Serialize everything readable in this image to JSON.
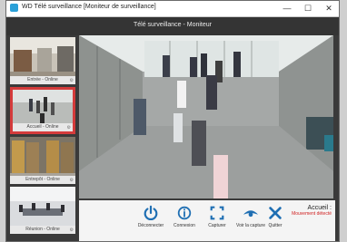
{
  "window": {
    "title": "WD Télé surveillance [Moniteur de surveillance]",
    "minimize": "—",
    "maximize": "☐",
    "close": "✕"
  },
  "header": {
    "title": "Télé surveillance - Moniteur"
  },
  "cameras": [
    {
      "label": "Entrée - Online",
      "active": false
    },
    {
      "label": "Accueil - Online",
      "active": true
    },
    {
      "label": "Entrepôt - Online",
      "active": false
    },
    {
      "label": "Réunion - Online",
      "active": false
    }
  ],
  "controls": [
    {
      "label": "Déconnecter",
      "icon": "power-icon"
    },
    {
      "label": "Connexion",
      "icon": "info-icon"
    },
    {
      "label": "Capturer",
      "icon": "capture-icon"
    },
    {
      "label": "Voir la capture",
      "icon": "eye-icon"
    },
    {
      "label": "Quitter",
      "icon": "close-icon"
    }
  ],
  "alert": {
    "title": "Accueil :",
    "message": "Mouvement détecté"
  },
  "colors": {
    "accent": "#1f6fb3",
    "alert": "#d02020",
    "active_border": "#d43b3b"
  }
}
